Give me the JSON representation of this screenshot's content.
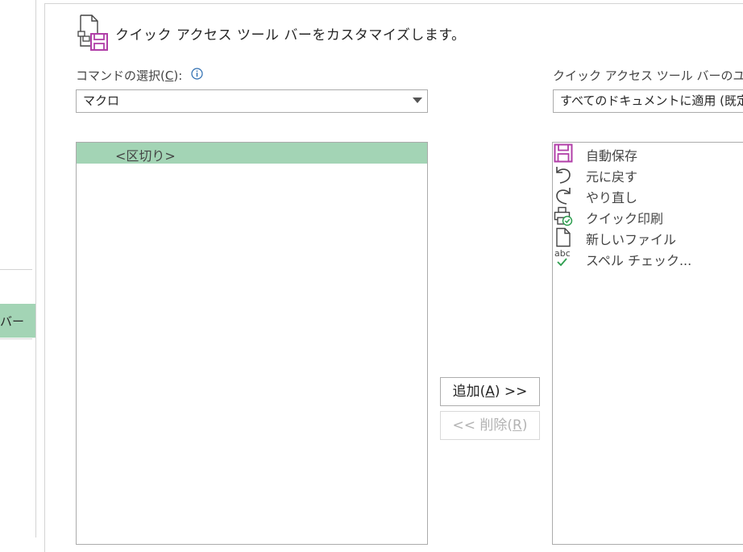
{
  "nav": {
    "selected_label": "バー"
  },
  "header": {
    "title": "クイック アクセス ツール バーをカスタマイズします。",
    "icon": "customize-qat-icon"
  },
  "choose_commands": {
    "label_prefix": "コマンドの選択(",
    "label_accel": "C",
    "label_suffix": "):",
    "selected": "マクロ",
    "options_icon": "info-icon"
  },
  "customize": {
    "label": "クイック アクセス ツール バーのユー",
    "selected": "すべてのドキュメントに適用 (既定"
  },
  "commands_list": {
    "items": [
      "<区切り>"
    ]
  },
  "buttons": {
    "add_prefix": "追加(",
    "add_accel": "A",
    "add_suffix": ") >>",
    "remove_prefix": "<< 削除(",
    "remove_accel": "R",
    "remove_suffix": ")"
  },
  "qat_list": {
    "items": [
      {
        "label": "自動保存",
        "icon": "autosave-icon"
      },
      {
        "label": "元に戻す",
        "icon": "undo-icon"
      },
      {
        "label": "やり直し",
        "icon": "redo-icon"
      },
      {
        "label": "クイック印刷",
        "icon": "quick-print-icon"
      },
      {
        "label": "新しいファイル",
        "icon": "new-file-icon"
      },
      {
        "label": "スペル チェック...",
        "icon": "spelling-icon"
      }
    ]
  },
  "colors": {
    "selection": "#a3d4b5",
    "accent_purple": "#b13fa8",
    "check_green": "#2e9e4f"
  }
}
